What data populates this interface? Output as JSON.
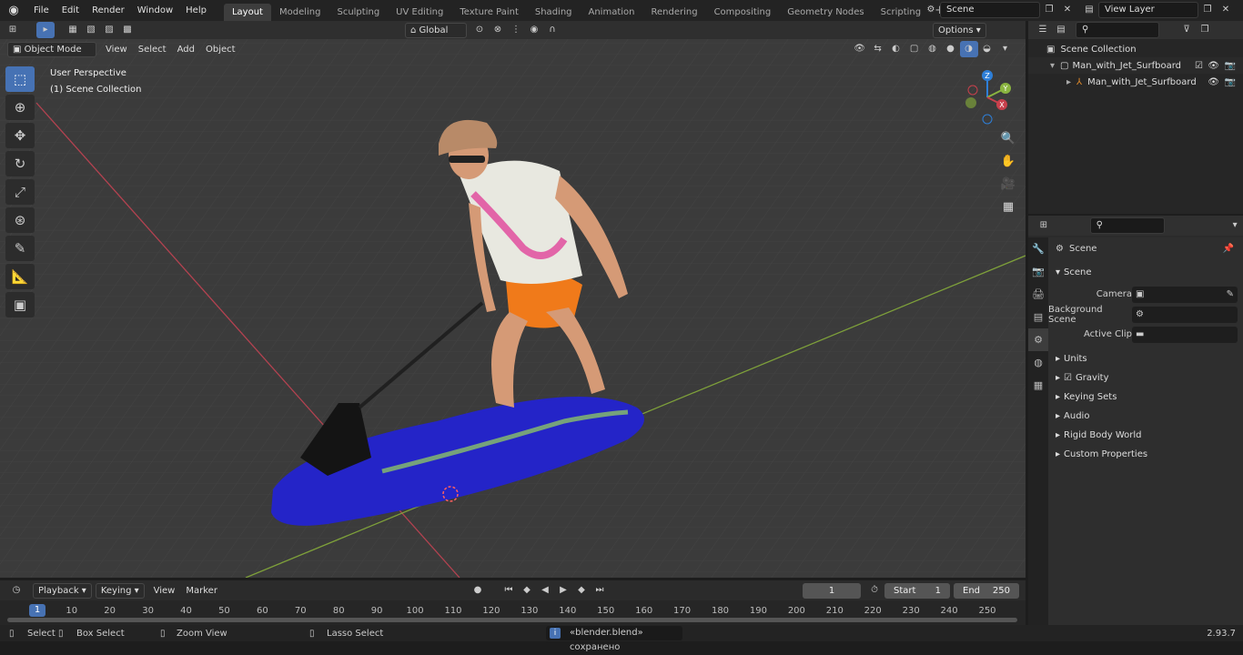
{
  "topbar": {
    "menus": [
      "File",
      "Edit",
      "Render",
      "Window",
      "Help"
    ],
    "workspaces": [
      "Layout",
      "Modeling",
      "Sculpting",
      "UV Editing",
      "Texture Paint",
      "Shading",
      "Animation",
      "Rendering",
      "Compositing",
      "Geometry Nodes",
      "Scripting"
    ],
    "active_workspace": "Layout",
    "scene": "Scene",
    "view_layer": "View Layer"
  },
  "viewport": {
    "transform_orientation": "Global",
    "options_label": "Options",
    "mode": "Object Mode",
    "menus": [
      "View",
      "Select",
      "Add",
      "Object"
    ],
    "overlay_title": "User Perspective",
    "overlay_subtitle": "(1) Scene Collection",
    "gizmo_axes": {
      "x": "X",
      "y": "Y",
      "z": "Z"
    }
  },
  "outliner": {
    "root": "Scene Collection",
    "collection": "Man_with_Jet_Surfboard",
    "object": "Man_with_Jet_Surfboard"
  },
  "properties": {
    "context": "Scene",
    "panel": "Scene",
    "fields": {
      "camera": "Camera",
      "background_scene": "Background Scene",
      "active_clip": "Active Clip"
    },
    "subpanels": [
      "Units",
      "Gravity",
      "Keying Sets",
      "Audio",
      "Rigid Body World",
      "Custom Properties"
    ],
    "gravity_checked": true
  },
  "timeline": {
    "menus": [
      "Playback",
      "Keying",
      "View",
      "Marker"
    ],
    "current_frame": "1",
    "start_label": "Start",
    "start": "1",
    "end_label": "End",
    "end": "250",
    "ruler": [
      "1",
      "10",
      "20",
      "30",
      "40",
      "50",
      "60",
      "70",
      "80",
      "90",
      "100",
      "110",
      "120",
      "130",
      "140",
      "150",
      "160",
      "170",
      "180",
      "190",
      "200",
      "210",
      "220",
      "230",
      "240",
      "250"
    ]
  },
  "statusbar": {
    "select": "Select",
    "box_select": "Box Select",
    "zoom_view": "Zoom View",
    "lasso_select": "Lasso Select",
    "message": "«blender.blend» сохранено",
    "version": "2.93.7"
  },
  "colors": {
    "accent": "#4772b3",
    "x_axis": "#c8404c",
    "y_axis": "#8ab440",
    "z_axis": "#2e7fd8",
    "board": "#2323c8",
    "shirt": "#e8e8e0",
    "shorts": "#f07a1a"
  }
}
